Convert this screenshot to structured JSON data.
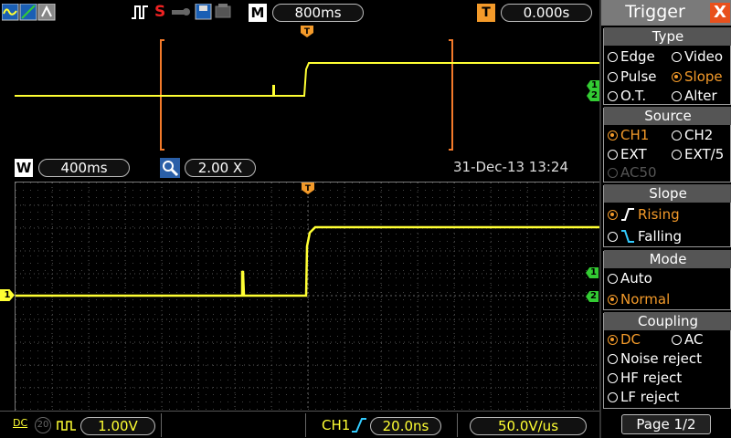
{
  "top_bar": {
    "mode_label": "M",
    "timebase": "800ms",
    "trigger_pos_label": "T",
    "trigger_offset": "0.000s",
    "status_letter": "S"
  },
  "mid_bar": {
    "window_label": "W",
    "window_timebase": "400ms",
    "zoom_value": "2.00 X",
    "datetime": "31-Dec-13 13:24"
  },
  "bottom_bar": {
    "coupling_label": "DC",
    "bw_label": "20",
    "ch_scale": "1.00V",
    "trig_source": "CH1",
    "trig_time": "20.0ns",
    "slew_rate": "50.0V/us"
  },
  "markers": {
    "trigger": "T",
    "ch1": "1",
    "ch2": "2"
  },
  "menu": {
    "title": "Trigger",
    "close": "X",
    "type": {
      "title": "Type",
      "options": [
        "Edge",
        "Video",
        "Pulse",
        "Slope",
        "O.T.",
        "Alter"
      ],
      "selected": "Slope"
    },
    "source": {
      "title": "Source",
      "options": [
        "CH1",
        "CH2",
        "EXT",
        "EXT/5",
        "AC50"
      ],
      "selected": "CH1"
    },
    "slope": {
      "title": "Slope",
      "options": [
        "Rising",
        "Falling"
      ],
      "selected": "Rising"
    },
    "mode": {
      "title": "Mode",
      "options": [
        "Auto",
        "Normal"
      ],
      "selected": "Normal"
    },
    "coupling": {
      "title": "Coupling",
      "options": [
        "DC",
        "AC",
        "Noise reject",
        "HF reject",
        "LF reject"
      ],
      "selected": "DC"
    },
    "page": "Page 1/2"
  },
  "colors": {
    "trace": "#ffff33",
    "accent": "#f39a2a",
    "marker_green": "#33cc33"
  }
}
